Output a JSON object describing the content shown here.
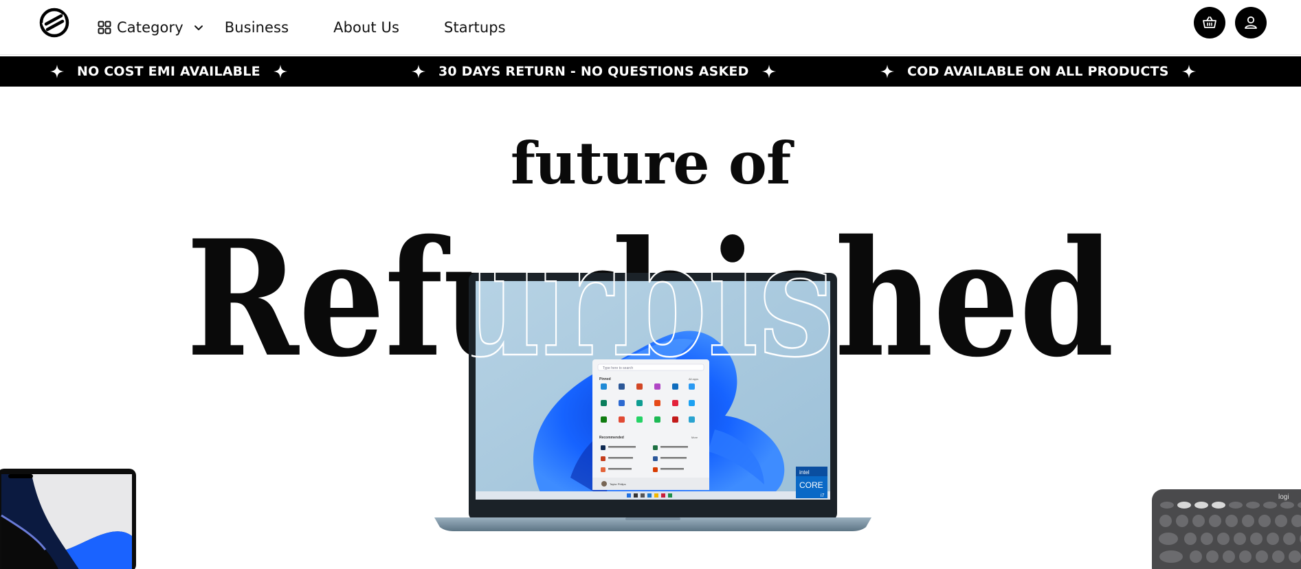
{
  "header": {
    "logo_icon": "brand-logo-icon",
    "nav": {
      "category_label": "Category",
      "business_label": "Business",
      "about_label": "About Us",
      "startups_label": "Startups"
    },
    "cart_icon": "basket-icon",
    "user_icon": "user-icon"
  },
  "ticker": {
    "items": [
      "NO COST EMI AVAILABLE",
      "30 DAYS RETURN - NO QUESTIONS ASKED",
      "COD AVAILABLE ON ALL PRODUCTS"
    ],
    "background": "#000000",
    "text_color": "#ffffff"
  },
  "hero": {
    "line1": "future of",
    "line2": "Refurbished"
  },
  "laptop_screen": {
    "search_placeholder": "Type here to search",
    "pinned_label": "Pinned",
    "all_apps_label": "All apps",
    "recommended_label": "Recommended",
    "more_label": "More",
    "user_name": "Taylor Philips"
  },
  "intel_badge": {
    "brand": "intel",
    "line": "CORE",
    "tier": "i7"
  },
  "keyboard": {
    "brand": "logi"
  },
  "colors": {
    "text": "#0a0a0a",
    "accent_blue": "#1a5fd9"
  }
}
